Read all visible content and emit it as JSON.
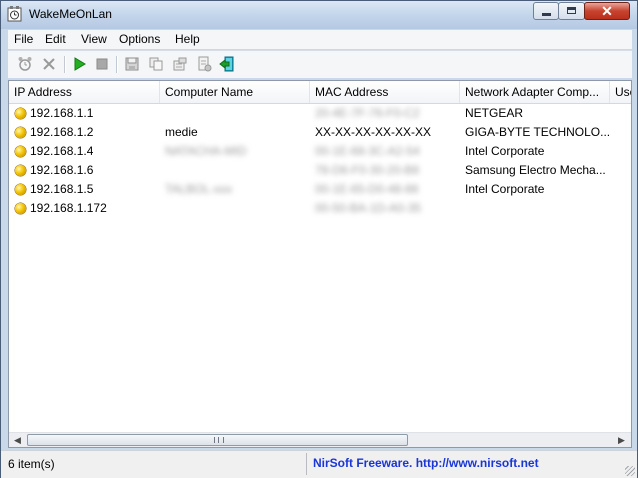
{
  "window": {
    "title": "WakeMeOnLan",
    "app_icon": "alarm-clock-icon"
  },
  "menu": [
    "File",
    "Edit",
    "View",
    "Options",
    "Help"
  ],
  "toolbar": {
    "buttons": [
      {
        "name": "start-scanning-icon",
        "enabled": false
      },
      {
        "name": "delete-icon",
        "enabled": false
      },
      {
        "name": "wake-up-play-icon",
        "enabled": true
      },
      {
        "name": "stop-icon",
        "enabled": false
      },
      {
        "name": "save-icon",
        "enabled": false
      },
      {
        "name": "copy-icon",
        "enabled": false
      },
      {
        "name": "properties-icon",
        "enabled": false
      },
      {
        "name": "html-report-icon",
        "enabled": false
      },
      {
        "name": "exit-icon",
        "enabled": true
      }
    ]
  },
  "columns": [
    "IP Address",
    "Computer Name",
    "MAC Address",
    "Network Adapter Comp...",
    "Use"
  ],
  "rows": [
    {
      "ip": "192.168.1.1",
      "computer": "",
      "mac": "20-4E-7F-76-F0-C2",
      "mac_blurred": true,
      "adapter": "NETGEAR"
    },
    {
      "ip": "192.168.1.2",
      "computer": "medie",
      "mac": "XX-XX-XX-XX-XX-XX",
      "mac_blurred": false,
      "adapter": "GIGA-BYTE TECHNOLO..."
    },
    {
      "ip": "192.168.1.4",
      "computer": "NATACHA-MID",
      "computer_blurred": true,
      "mac": "00-1E-68-3C-A2-54",
      "mac_blurred": true,
      "adapter": "Intel Corporate"
    },
    {
      "ip": "192.168.1.6",
      "computer": "",
      "mac": "78-D6-F0-30-20-B8",
      "mac_blurred": true,
      "adapter": "Samsung Electro Mecha..."
    },
    {
      "ip": "192.168.1.5",
      "computer": "TALBOL-xxx",
      "computer_blurred": true,
      "mac": "00-1E-65-D0-48-88",
      "mac_blurred": true,
      "adapter": "Intel Corporate"
    },
    {
      "ip": "192.168.1.172",
      "computer": "",
      "mac": "00-50-BA-1D-A0-35",
      "mac_blurred": true,
      "adapter": ""
    }
  ],
  "status": {
    "items": "6 item(s)",
    "credit": "NirSoft Freeware.  http://www.nirsoft.net"
  },
  "colors": {
    "status_dot": "#f4c400",
    "link": "#1a36d6",
    "titlebar": "#c1d4ea"
  }
}
